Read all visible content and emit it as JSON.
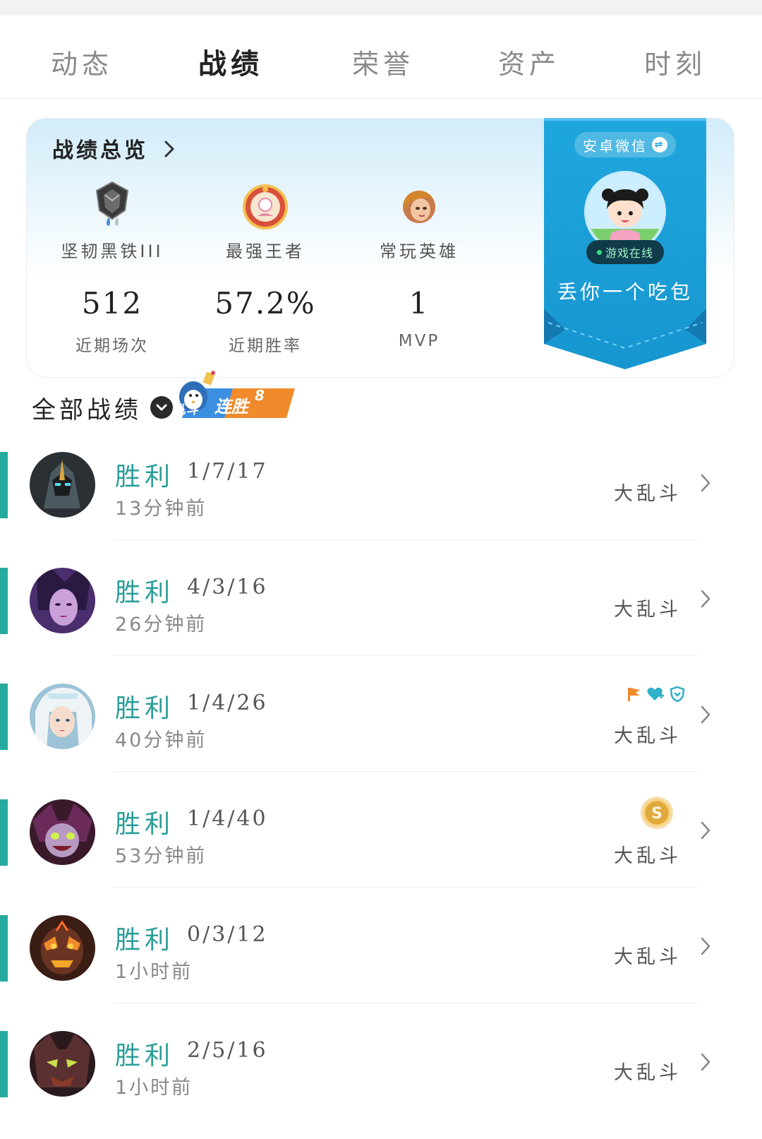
{
  "tabs": [
    {
      "label": "动态",
      "active": false
    },
    {
      "label": "战绩",
      "active": true
    },
    {
      "label": "荣誉",
      "active": false
    },
    {
      "label": "资产",
      "active": false
    },
    {
      "label": "时刻",
      "active": false
    }
  ],
  "overview": {
    "title": "战绩总览",
    "rank_label": "坚韧黑铁III",
    "strongest_label": "最强王者",
    "hero_label": "常玩英雄",
    "recent_games": "512",
    "recent_games_label": "近期场次",
    "win_rate": "57.2%",
    "win_rate_label": "近期胜率",
    "mvp": "1",
    "mvp_label": "MVP"
  },
  "profile": {
    "account": "安卓微信",
    "status": "游戏在线",
    "nickname": "丢你一个吃包"
  },
  "all_records": {
    "title": "全部战绩",
    "streak_prefix": "乱斗",
    "streak_label": "连胜",
    "streak_count": "8"
  },
  "matches": [
    {
      "result": "胜利",
      "kda": "1/7/17",
      "time": "13分钟前",
      "mode": "大乱斗",
      "badges": []
    },
    {
      "result": "胜利",
      "kda": "4/3/16",
      "time": "26分钟前",
      "mode": "大乱斗",
      "badges": []
    },
    {
      "result": "胜利",
      "kda": "1/4/26",
      "time": "40分钟前",
      "mode": "大乱斗",
      "badges": [
        "flag-icon",
        "heart-plus-icon",
        "shield-icon"
      ]
    },
    {
      "result": "胜利",
      "kda": "1/4/40",
      "time": "53分钟前",
      "mode": "大乱斗",
      "badges": [
        "s-medal-icon"
      ]
    },
    {
      "result": "胜利",
      "kda": "0/3/12",
      "time": "1小时前",
      "mode": "大乱斗",
      "badges": []
    },
    {
      "result": "胜利",
      "kda": "2/5/16",
      "time": "1小时前",
      "mode": "大乱斗",
      "badges": []
    }
  ],
  "colors": {
    "win": "#2b9e99",
    "accent_bar": "#27aa9e",
    "ribbon": "#1aa0d6"
  }
}
